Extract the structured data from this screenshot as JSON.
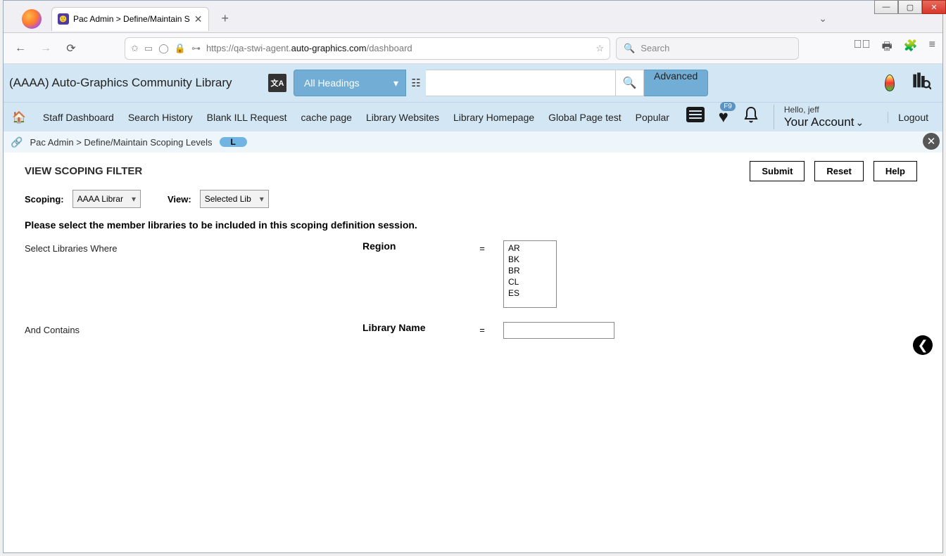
{
  "os": {
    "minimize": "—",
    "maximize": "▢",
    "close": "✕"
  },
  "browser_tab": {
    "title": "Pac Admin > Define/Maintain S",
    "close": "✕",
    "newtab": "+"
  },
  "url": {
    "prefix": "https://qa-stwi-agent.",
    "host": "auto-graphics.com",
    "path": "/dashboard"
  },
  "chrome_search_placeholder": "Search",
  "header": {
    "library_title": "(AAAA) Auto-Graphics Community Library",
    "headings_label": "All Headings",
    "advanced_label": "Advanced",
    "hello": "Hello, jeff",
    "account": "Your Account",
    "logout": "Logout",
    "badge_f9": "F9"
  },
  "nav": {
    "items": [
      "Staff Dashboard",
      "Search History",
      "Blank ILL Request",
      "cache page",
      "Library Websites",
      "Library Homepage",
      "Global Page test",
      "Popular"
    ]
  },
  "breadcrumb": {
    "text": "Pac Admin  >  Define/Maintain Scoping Levels",
    "badge": "L"
  },
  "page": {
    "title": "VIEW SCOPING FILTER",
    "submit": "Submit",
    "reset": "Reset",
    "help": "Help",
    "scoping_label": "Scoping:",
    "scoping_value": "AAAA Librar",
    "view_label": "View:",
    "view_value": "Selected Lib",
    "instruction": "Please select the member libraries to be included in this scoping definition session.",
    "select_where": "Select Libraries Where",
    "region_label": "Region",
    "eq": "=",
    "regions": [
      "AR",
      "BK",
      "BR",
      "CL",
      "ES"
    ],
    "and_contains": "And Contains",
    "library_name_label": "Library Name",
    "libname_value": ""
  }
}
